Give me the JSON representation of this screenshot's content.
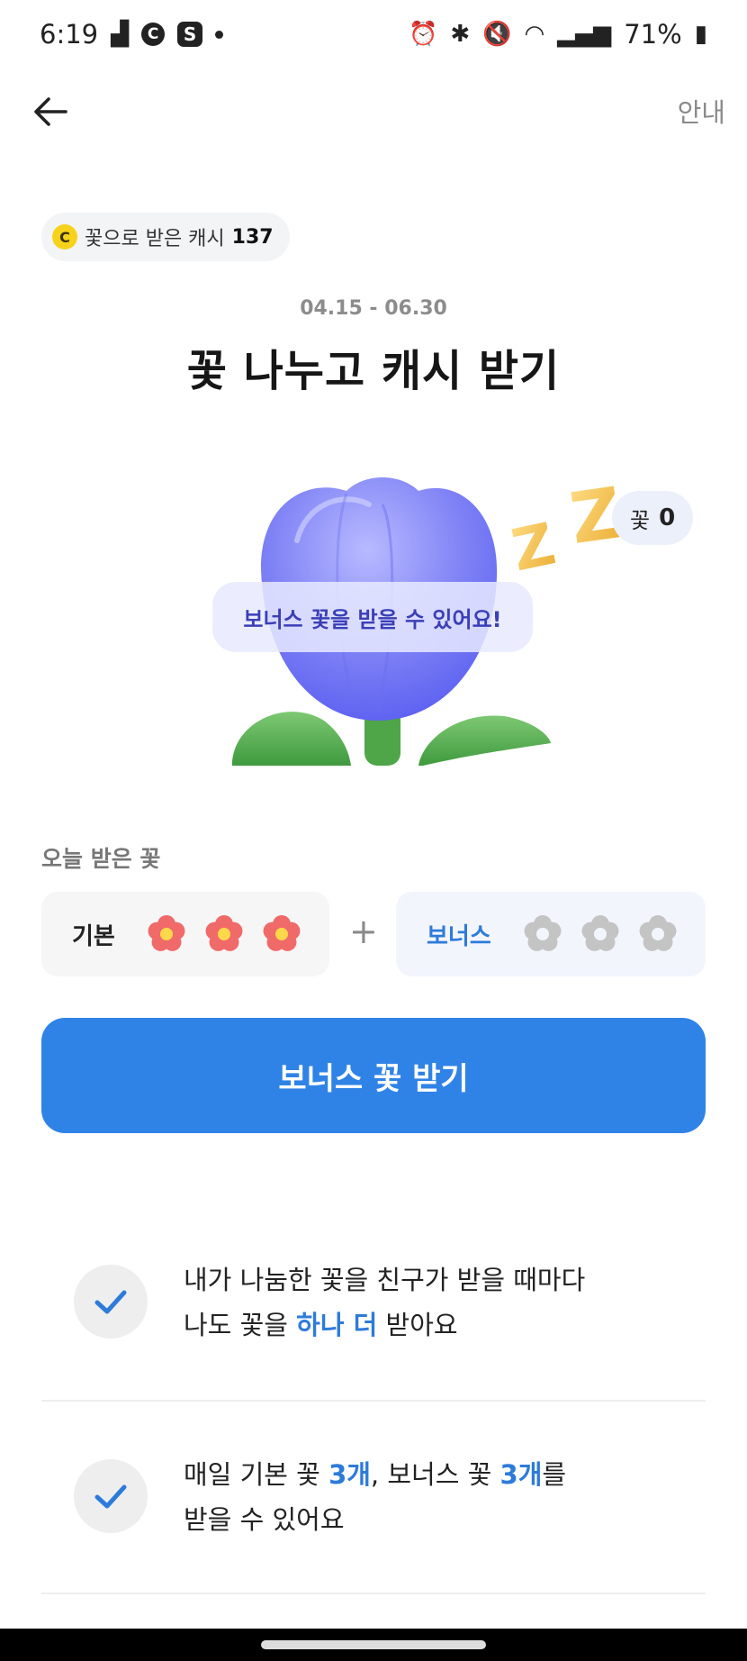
{
  "status": {
    "time": "6:19",
    "icon_c": "C",
    "icon_s": "S",
    "battery": "71%"
  },
  "header": {
    "guide_label": "안내"
  },
  "cash_chip": {
    "coin_letter": "C",
    "label": "꽃으로 받은 캐시",
    "value": "137"
  },
  "event": {
    "period": "04.15 - 06.30",
    "title": "꽃 나누고 캐시 받기"
  },
  "hero": {
    "bonus_message": "보너스 꽃을 받을 수 있어요!",
    "count_label": "꽃",
    "count_value": "0"
  },
  "today": {
    "label": "오늘 받은 꽃",
    "basic_label": "기본",
    "basic_received": 3,
    "bonus_label": "보너스",
    "bonus_received": 0,
    "plus": "+"
  },
  "cta": {
    "label": "보너스 꽃 받기"
  },
  "info": [
    {
      "line1": "내가 나눔한 꽃을 친구가 받을 때마다",
      "line2_pre": "나도 꽃을 ",
      "line2_hl": "하나 더",
      "line2_post": " 받아요"
    },
    {
      "line1_pre": "매일 기본 꽃 ",
      "line1_hl1": "3개",
      "line1_mid": ", 보너스 꽃 ",
      "line1_hl2": "3개",
      "line1_post": "를",
      "line2": "받을 수 있어요"
    }
  ],
  "colors": {
    "accent": "#3083e6",
    "highlight": "#2d7bd9",
    "flower_basic": "#f06a6a",
    "flower_center": "#ffd84a",
    "flower_empty": "#c4c4c4",
    "tulip": "#7b7ef4"
  },
  "icons": [
    "back-arrow-icon",
    "coin-icon",
    "zzz-icon",
    "flower-icon",
    "check-icon"
  ]
}
